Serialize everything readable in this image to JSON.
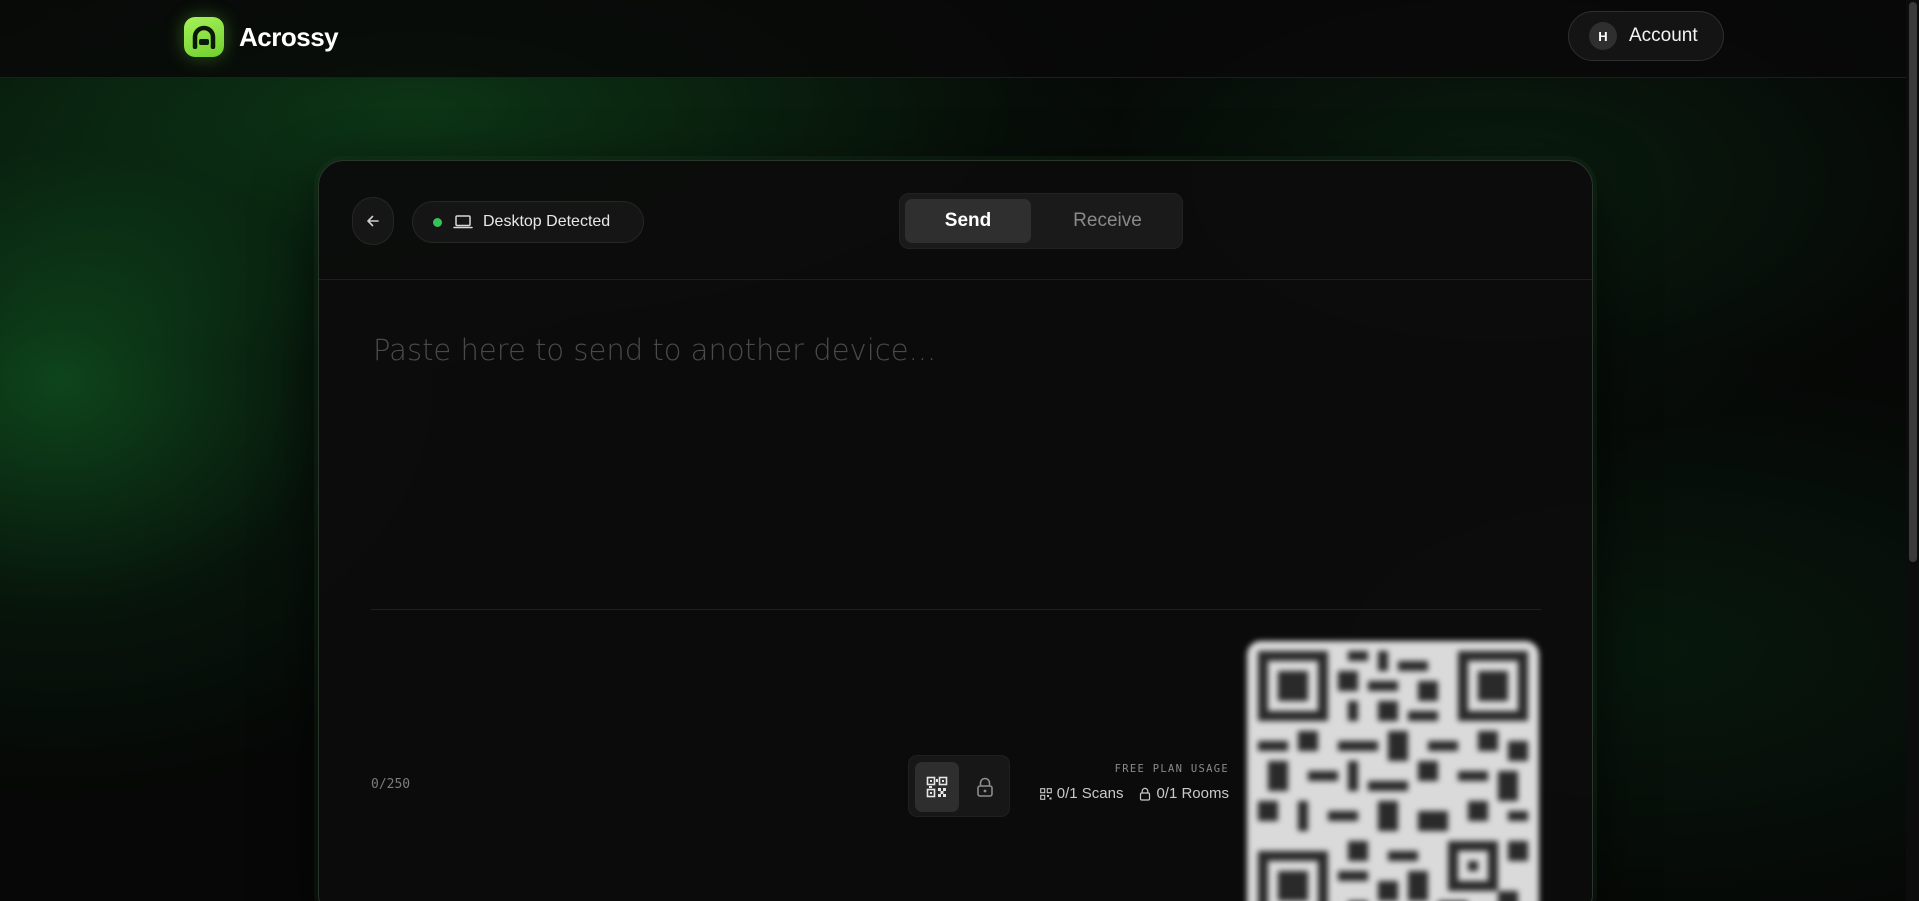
{
  "brand": {
    "name": "Acrossy",
    "logo_icon": "acrossy-logo-icon",
    "accent": "#8be33e"
  },
  "account": {
    "avatar_initial": "H",
    "label": "Account"
  },
  "card": {
    "device_status": {
      "label": "Desktop Detected",
      "status_color": "#36c25b",
      "icon": "laptop-icon"
    },
    "tabs": [
      {
        "label": "Send",
        "active": true
      },
      {
        "label": "Receive",
        "active": false
      }
    ],
    "input": {
      "value": "",
      "placeholder": "Paste here to send to another device..."
    },
    "char_count": "0/250",
    "modes": [
      {
        "icon": "qr-code-icon",
        "active": true
      },
      {
        "icon": "lock-icon",
        "active": false
      }
    ],
    "usage": {
      "title": "FREE PLAN USAGE",
      "scans": "0/1 Scans",
      "rooms": "0/1 Rooms"
    }
  }
}
